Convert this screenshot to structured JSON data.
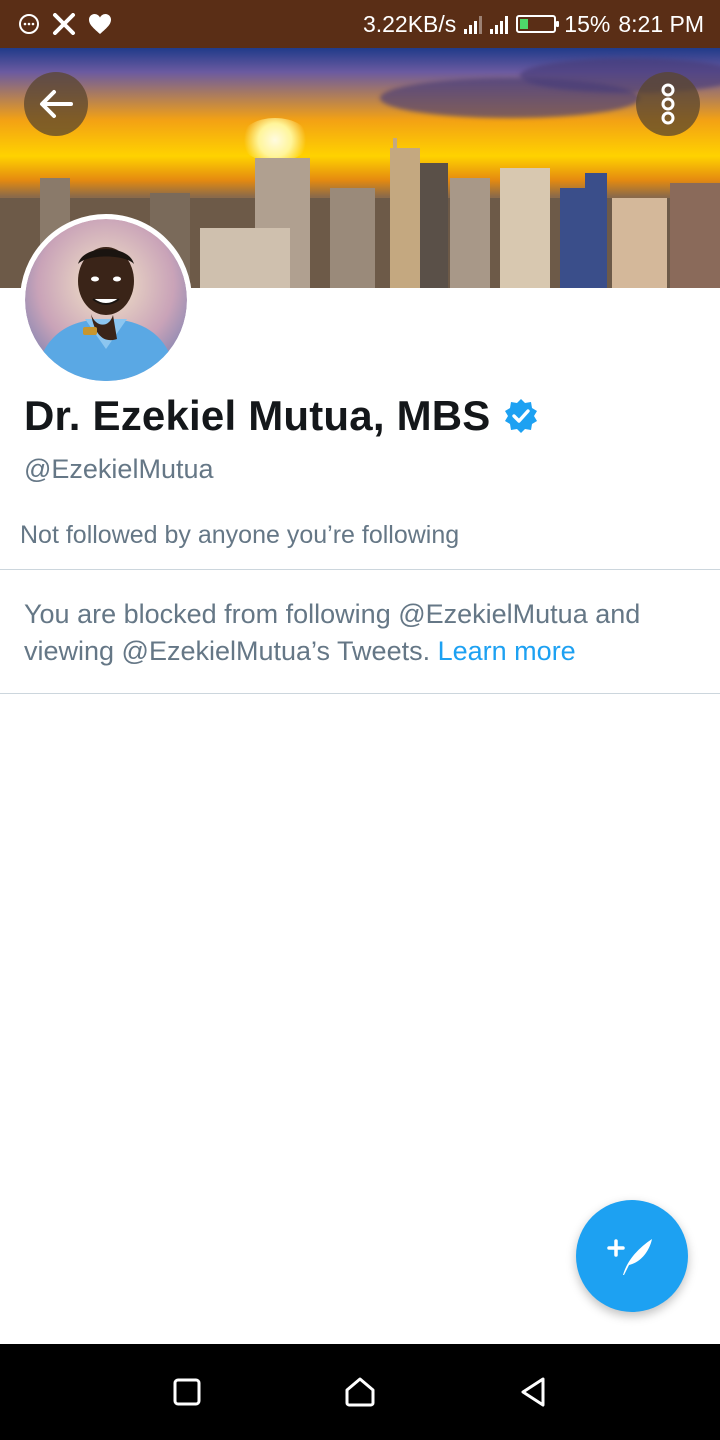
{
  "status_bar": {
    "net_speed": "3.22KB/s",
    "battery_percent": "15%",
    "time": "8:21 PM",
    "left_icons": [
      "chat-icon",
      "x-icon",
      "heart-icon"
    ]
  },
  "profile": {
    "name": "Dr. Ezekiel Mutua, MBS",
    "verified": true,
    "handle": "@EzekielMutua",
    "followed_by": "Not followed by anyone you’re following"
  },
  "blocked_notice": {
    "text": "You are blocked from following @EzekielMutua and viewing @EzekielMutua’s Tweets.",
    "link": "Learn more"
  },
  "colors": {
    "accent": "#1da1f2",
    "status_bar": "#5a2e16",
    "text_primary": "#14171a",
    "text_secondary": "#657786"
  },
  "icons": {
    "back": "arrow-left-icon",
    "more": "more-vertical-icon",
    "compose": "compose-tweet-icon",
    "nav": [
      "recents-square-icon",
      "home-icon",
      "back-triangle-icon"
    ]
  }
}
